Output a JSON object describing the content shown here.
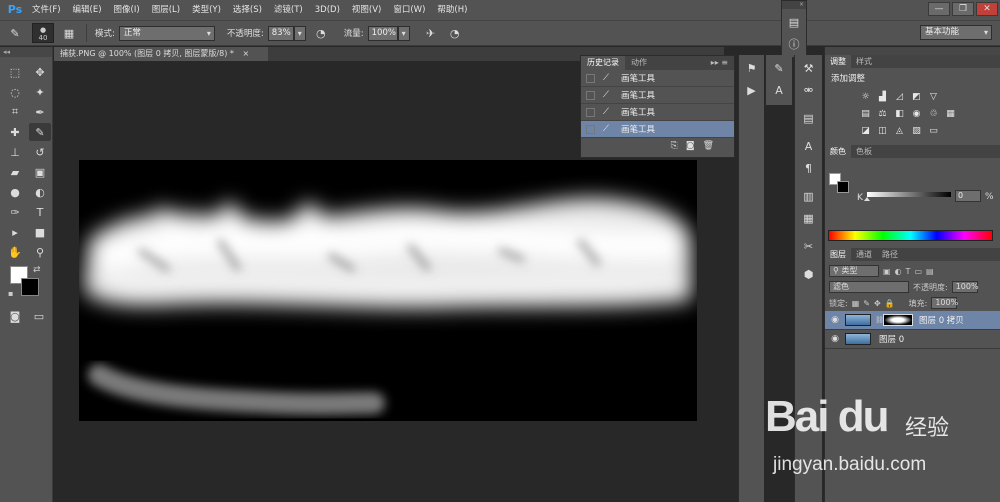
{
  "app": {
    "logo": "Ps"
  },
  "menu": [
    "文件(F)",
    "编辑(E)",
    "图像(I)",
    "图层(L)",
    "类型(Y)",
    "选择(S)",
    "滤镜(T)",
    "3D(D)",
    "视图(V)",
    "窗口(W)",
    "帮助(H)"
  ],
  "window_controls": {
    "minimize": "—",
    "restore": "❐",
    "close": "✕"
  },
  "options": {
    "brush_size": "40",
    "mode_label": "模式:",
    "mode_value": "正常",
    "opacity_label": "不透明度:",
    "opacity_value": "83%",
    "flow_label": "流量:",
    "flow_value": "100%",
    "workspace": "基本功能"
  },
  "document": {
    "tab_title": "捕获.PNG @ 100% (图层 0 拷贝, 图层蒙版/8) *",
    "close": "×"
  },
  "history": {
    "tabs": [
      "历史记录",
      "动作"
    ],
    "items": [
      "画笔工具",
      "画笔工具",
      "画笔工具",
      "画笔工具"
    ]
  },
  "adjustments": {
    "tabs": [
      "调整",
      "样式"
    ],
    "title": "添加调整"
  },
  "color_panel": {
    "tabs": [
      "颜色",
      "色板"
    ],
    "channel": "K",
    "value": "0",
    "unit": "%",
    "k_level": 0
  },
  "layers": {
    "tabs": [
      "图层",
      "通道",
      "路径"
    ],
    "filter": "类型",
    "blend": "滤色",
    "opacity_label": "不透明度:",
    "opacity_value": "100%",
    "lock_label": "锁定:",
    "fill_label": "填充:",
    "fill_value": "100%",
    "items": [
      {
        "name": "图层 0 拷贝",
        "selected": true
      },
      {
        "name": "图层 0",
        "selected": false
      }
    ]
  },
  "watermark": {
    "logo": "Bai du",
    "brand": "经验",
    "url": "jingyan.baidu.com"
  },
  "colors": {
    "accent": "#6f85a8",
    "ps_blue": "#3ea3f4",
    "foreground": "#ffffff",
    "background": "#000000"
  }
}
